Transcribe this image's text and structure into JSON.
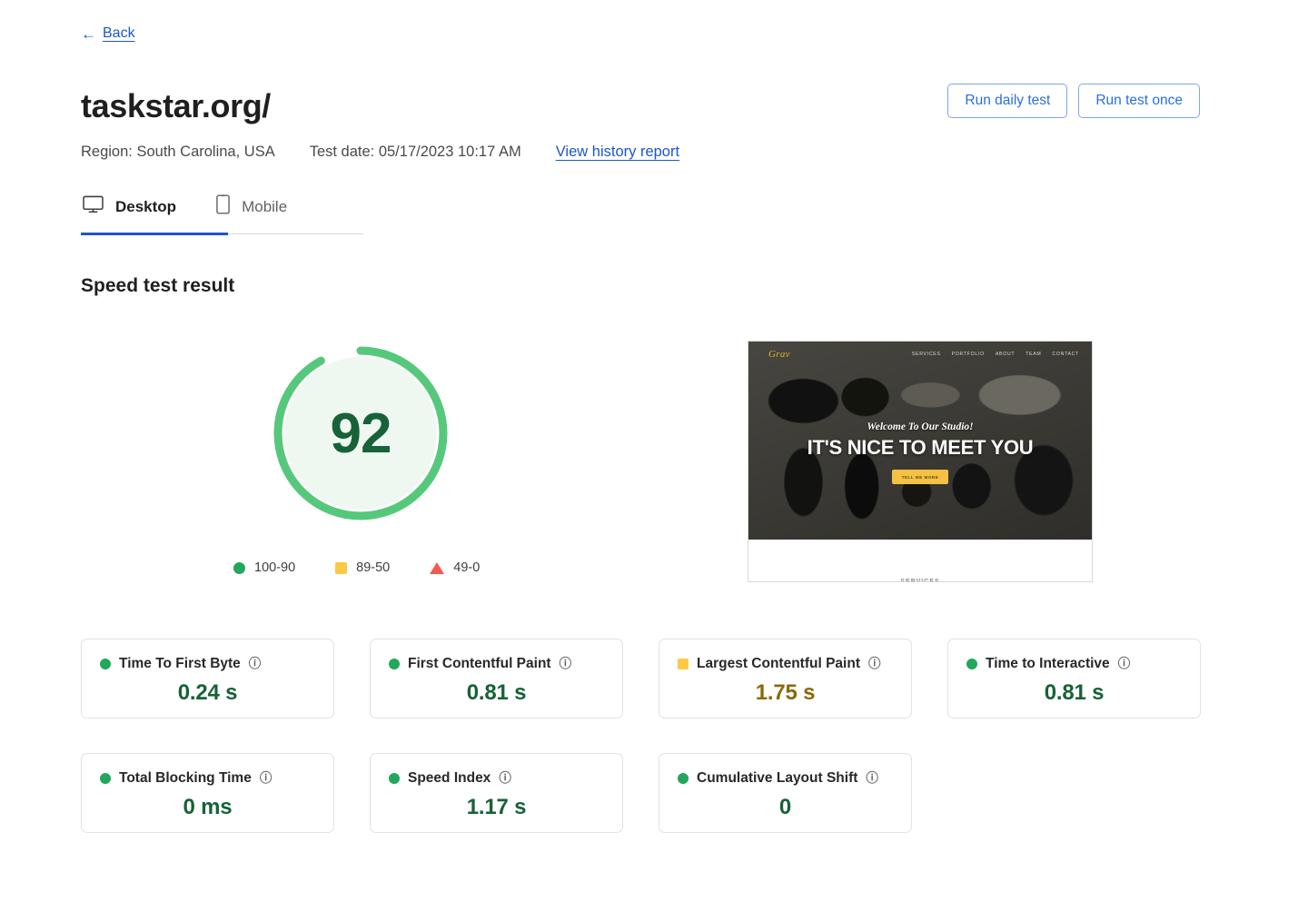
{
  "nav": {
    "back_label": "Back",
    "back_icon": "arrow-left-icon"
  },
  "header": {
    "site_url": "taskstar.org/",
    "region": "Region: South Carolina, USA",
    "test_date": "Test date: 05/17/2023 10:17 AM",
    "history_link": "View history report",
    "buttons": {
      "run_daily": "Run daily test",
      "run_once": "Run test once"
    }
  },
  "tabs": [
    {
      "label": "Desktop",
      "icon": "monitor-icon",
      "active": true
    },
    {
      "label": "Mobile",
      "icon": "smartphone-icon",
      "active": false
    }
  ],
  "main": {
    "section_title": "Speed test result",
    "score": "92",
    "score_value": 92,
    "legend": [
      {
        "shape": "circle",
        "label": "100-90",
        "color": "#22a75c"
      },
      {
        "shape": "square",
        "label": "89-50",
        "color": "#fbc944"
      },
      {
        "shape": "triangle",
        "label": "49-0",
        "color": "#f4594b"
      }
    ]
  },
  "thumbnail": {
    "logo": "Grav",
    "menu": [
      "SERVICES",
      "PORTFOLIO",
      "ABOUT",
      "TEAM",
      "CONTACT"
    ],
    "tagline": "Welcome To Our Studio!",
    "heading": "IT'S NICE TO MEET YOU",
    "cta": "TELL ME MORE",
    "below_fold_text": "SERVICES"
  },
  "metrics": [
    {
      "label": "Time To First Byte",
      "value": "0.24 s",
      "status": "green",
      "info": "info-icon"
    },
    {
      "label": "First Contentful Paint",
      "value": "0.81 s",
      "status": "green",
      "info": "info-icon"
    },
    {
      "label": "Largest Contentful Paint",
      "value": "1.75 s",
      "status": "yellow",
      "info": "info-icon"
    },
    {
      "label": "Time to Interactive",
      "value": "0.81 s",
      "status": "green",
      "info": "info-icon"
    },
    {
      "label": "Total Blocking Time",
      "value": "0 ms",
      "status": "green",
      "info": "info-icon"
    },
    {
      "label": "Speed Index",
      "value": "1.17 s",
      "status": "green",
      "info": "info-icon"
    },
    {
      "label": "Cumulative Layout Shift",
      "value": "0",
      "status": "green",
      "info": "info-icon"
    }
  ],
  "colors": {
    "accent_blue": "#1a56cf",
    "good_green": "#22a75c",
    "score_green": "#176236",
    "gauge_arc": "#56c87c",
    "gauge_fill": "#eef8f1",
    "warn_yellow": "#fbc944",
    "warn_text": "#8a6a06",
    "bad_red": "#f4594b"
  }
}
